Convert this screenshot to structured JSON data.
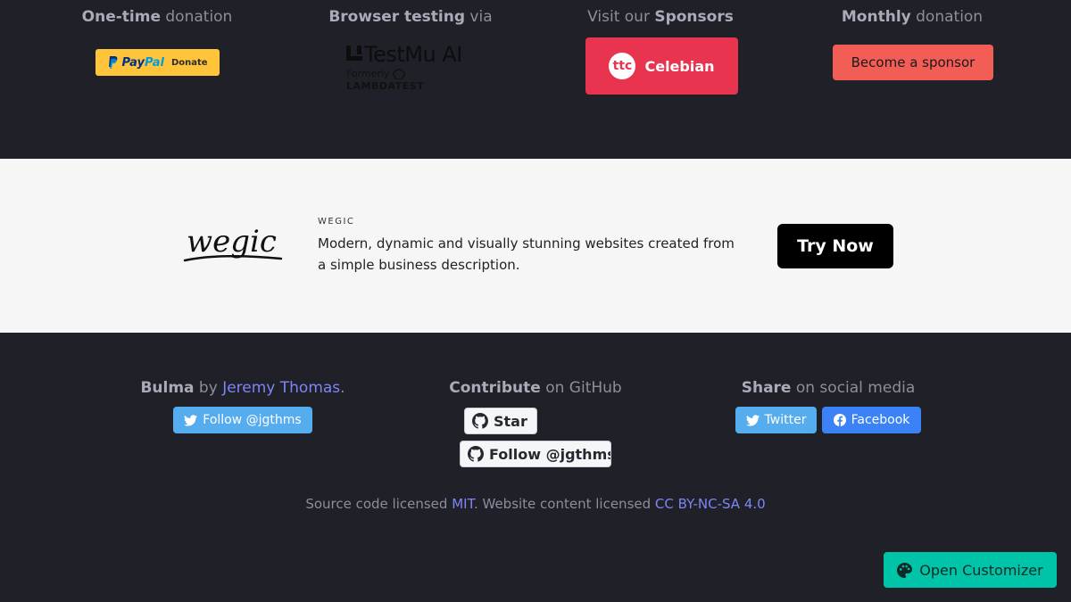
{
  "sponsors": {
    "one_time": {
      "bold": "One-time",
      "rest": " donation"
    },
    "paypal": {
      "pay": "Pay",
      "pal": "Pal",
      "donate": "Donate"
    },
    "browser": {
      "bold": "Browser testing",
      "rest": " via"
    },
    "testmu": {
      "name": "TestMu AI",
      "formerly": "Formerly",
      "lambda": "LAMBDATEST"
    },
    "visit": {
      "rest": "Visit our ",
      "bold": "Sponsors"
    },
    "celebian": {
      "label": "Celebian",
      "logo_glyph": "ttc"
    },
    "monthly": {
      "bold": "Monthly",
      "rest": " donation"
    },
    "become_label": "Become a sponsor"
  },
  "ad": {
    "kicker": "WEGIC",
    "text": "Modern, dynamic and visually stunning websites created from a simple business description.",
    "cta": "Try Now",
    "logo_text": "wegic"
  },
  "footer": {
    "bulma": {
      "bold": "Bulma",
      "by": " by ",
      "author": "Jeremy Thomas",
      "dot": "."
    },
    "follow_twitter": "Follow @jgthms",
    "contribute": {
      "bold": "Contribute",
      "rest": " on GitHub"
    },
    "gh_star": "Star",
    "gh_follow": "Follow @jgthms",
    "share": {
      "bold": "Share",
      "rest": " on social media"
    },
    "twitter": "Twitter",
    "facebook": "Facebook",
    "license": {
      "pre": "Source code licensed ",
      "mit": "MIT",
      "mid": ". Website content licensed ",
      "cc": "CC BY-NC-SA 4.0"
    }
  },
  "customizer_label": "Open Customizer",
  "colors": {
    "background": "#1f2028",
    "link": "#7d86f5",
    "paypal": "#ffc439",
    "celebian": "#e8344e",
    "sponsor_button": "#f25d55",
    "twitter": "#55acee",
    "facebook": "#3b82f6",
    "customizer": "#00c4a7"
  },
  "icons": [
    "paypal-icon",
    "testmu-icon",
    "lambdatest-icon",
    "celebian-icon",
    "wegic-logo",
    "twitter-icon",
    "github-icon",
    "facebook-icon",
    "palette-icon"
  ]
}
